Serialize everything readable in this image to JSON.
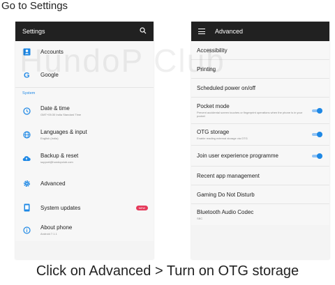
{
  "heading": "Go to Settings",
  "watermark": "HundoP Club",
  "caption": "Click on Advanced > Turn on OTG storage",
  "left": {
    "title": "Settings",
    "items_top": [
      {
        "label": "Accounts",
        "icon": "account-icon"
      },
      {
        "label": "Google",
        "icon": "google-icon"
      }
    ],
    "section": "System",
    "items": [
      {
        "label": "Date & time",
        "sub": "GMT+05:30 India Standard Time",
        "icon": "clock-icon"
      },
      {
        "label": "Languages & input",
        "sub": "English (India)",
        "icon": "globe-icon"
      },
      {
        "label": "Backup & reset",
        "sub": "support@hundopclub.com",
        "icon": "cloud-upload-icon"
      },
      {
        "label": "Advanced",
        "icon": "gear-icon"
      },
      {
        "label": "System updates",
        "badge": "NEW",
        "icon": "phone-update-icon"
      },
      {
        "label": "About phone",
        "sub": "Android 7.1.1",
        "icon": "info-icon"
      }
    ]
  },
  "right": {
    "title": "Advanced",
    "items": [
      {
        "label": "Accessibility"
      },
      {
        "label": "Printing"
      },
      {
        "label": "Scheduled power on/off"
      },
      {
        "label": "Pocket mode",
        "sub": "Prevent accidental screen touches or fingerprint operations when the phone is in your pocket",
        "toggle": true
      },
      {
        "label": "OTG storage",
        "sub": "Enable reading external storage via OTG",
        "toggle": true
      },
      {
        "label": "Join user experience programme",
        "toggle": true
      },
      {
        "label": "Recent app management"
      },
      {
        "label": "Gaming Do Not Disturb"
      },
      {
        "label": "Bluetooth Audio Codec",
        "sub": "SBC"
      }
    ]
  },
  "colors": {
    "accent": "#1e88e5",
    "toolbar": "#212121",
    "badge": "#e5395a"
  }
}
